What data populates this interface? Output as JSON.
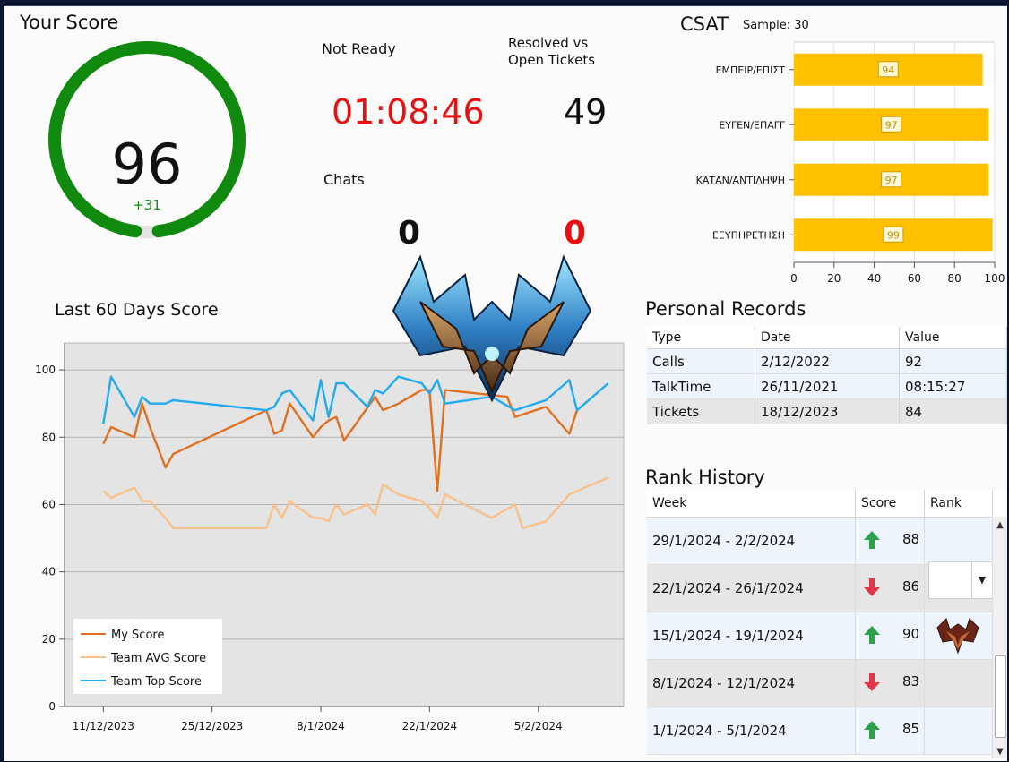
{
  "score": {
    "title": "Your Score",
    "value": "96",
    "delta": "+31",
    "percent": 96
  },
  "not_ready": {
    "label": "Not Ready",
    "value": "01:08:46"
  },
  "resolved": {
    "label_line1": "Resolved vs",
    "label_line2": "Open Tickets",
    "value": "49"
  },
  "chats": {
    "label": "Chats",
    "value_a": "0",
    "value_b": "0"
  },
  "csat": {
    "title": "CSAT",
    "sample": "Sample: 30",
    "chart_data": {
      "type": "bar",
      "orientation": "horizontal",
      "categories": [
        "ΕΜΠΕΙΡ/ΕΠΙΣΤ",
        "ΕΥΓΕΝ/ΕΠΑΓΓ",
        "ΚΑΤΑΝ/ΑΝΤΙΛΗΨΗ",
        "ΕΞΥΠΗΡΕΤΗΣΗ"
      ],
      "values": [
        94,
        97,
        97,
        99
      ],
      "xlim": [
        0,
        100
      ],
      "ticks": [
        "0",
        "20",
        "40",
        "60",
        "80",
        "100"
      ],
      "color": "#ffc000"
    }
  },
  "line_chart": {
    "title": "Last 60 Days Score",
    "chart_data": {
      "type": "line",
      "ylim": [
        0,
        108
      ],
      "yticks": [
        "0",
        "20",
        "40",
        "60",
        "80",
        "100"
      ],
      "x_ticks": [
        {
          "label": "11/12/2023",
          "date": "2023-12-11"
        },
        {
          "label": "25/12/2023",
          "date": "2023-12-25"
        },
        {
          "label": "8/1/2024",
          "date": "2024-01-08"
        },
        {
          "label": "22/1/2024",
          "date": "2024-01-22"
        },
        {
          "label": "5/2/2024",
          "date": "2024-02-05"
        }
      ],
      "xlim": [
        "2023-12-06",
        "2024-02-16"
      ],
      "series": [
        {
          "name": "My Score",
          "color": "#e07020",
          "points": [
            [
              "2023-12-11",
              78
            ],
            [
              "2023-12-12",
              83
            ],
            [
              "2023-12-15",
              80
            ],
            [
              "2023-12-16",
              90
            ],
            [
              "2023-12-17",
              83
            ],
            [
              "2023-12-19",
              71
            ],
            [
              "2023-12-20",
              75
            ],
            [
              "2024-01-01",
              88
            ],
            [
              "2024-01-02",
              81
            ],
            [
              "2024-01-03",
              82
            ],
            [
              "2024-01-04",
              90
            ],
            [
              "2024-01-07",
              80
            ],
            [
              "2024-01-08",
              83
            ],
            [
              "2024-01-09",
              85
            ],
            [
              "2024-01-10",
              86
            ],
            [
              "2024-01-11",
              79
            ],
            [
              "2024-01-15",
              92
            ],
            [
              "2024-01-16",
              88
            ],
            [
              "2024-01-18",
              90
            ],
            [
              "2024-01-21",
              94
            ],
            [
              "2024-01-22",
              94
            ],
            [
              "2024-01-23",
              64
            ],
            [
              "2024-01-24",
              94
            ],
            [
              "2024-02-01",
              92
            ],
            [
              "2024-02-02",
              86
            ],
            [
              "2024-02-06",
              89
            ],
            [
              "2024-02-09",
              81
            ],
            [
              "2024-02-10",
              88
            ]
          ]
        },
        {
          "name": "Team AVG Score",
          "color": "#f8c08a",
          "points": [
            [
              "2023-12-11",
              64
            ],
            [
              "2023-12-12",
              62
            ],
            [
              "2023-12-15",
              65
            ],
            [
              "2023-12-16",
              61
            ],
            [
              "2023-12-17",
              61
            ],
            [
              "2023-12-19",
              56
            ],
            [
              "2023-12-20",
              53
            ],
            [
              "2024-01-01",
              53
            ],
            [
              "2024-01-02",
              60
            ],
            [
              "2024-01-03",
              56
            ],
            [
              "2024-01-04",
              61
            ],
            [
              "2024-01-07",
              56
            ],
            [
              "2024-01-08",
              56
            ],
            [
              "2024-01-09",
              55
            ],
            [
              "2024-01-10",
              60
            ],
            [
              "2024-01-11",
              57
            ],
            [
              "2024-01-14",
              60
            ],
            [
              "2024-01-15",
              57
            ],
            [
              "2024-01-16",
              66
            ],
            [
              "2024-01-18",
              63
            ],
            [
              "2024-01-21",
              61
            ],
            [
              "2024-01-22",
              59
            ],
            [
              "2024-01-23",
              56
            ],
            [
              "2024-01-24",
              63
            ],
            [
              "2024-01-30",
              56
            ],
            [
              "2024-02-02",
              60
            ],
            [
              "2024-02-03",
              53
            ],
            [
              "2024-02-06",
              55
            ],
            [
              "2024-02-09",
              63
            ],
            [
              "2024-02-14",
              68
            ]
          ]
        },
        {
          "name": "Team Top Score",
          "color": "#22aaee",
          "points": [
            [
              "2023-12-11",
              84
            ],
            [
              "2023-12-12",
              98
            ],
            [
              "2023-12-15",
              86
            ],
            [
              "2023-12-16",
              92
            ],
            [
              "2023-12-17",
              90
            ],
            [
              "2023-12-19",
              90
            ],
            [
              "2023-12-20",
              91
            ],
            [
              "2024-01-01",
              88
            ],
            [
              "2024-01-02",
              89
            ],
            [
              "2024-01-03",
              93
            ],
            [
              "2024-01-04",
              94
            ],
            [
              "2024-01-07",
              85
            ],
            [
              "2024-01-08",
              97
            ],
            [
              "2024-01-09",
              86
            ],
            [
              "2024-01-10",
              96
            ],
            [
              "2024-01-11",
              96
            ],
            [
              "2024-01-14",
              89
            ],
            [
              "2024-01-15",
              94
            ],
            [
              "2024-01-16",
              93
            ],
            [
              "2024-01-18",
              98
            ],
            [
              "2024-01-21",
              96
            ],
            [
              "2024-01-22",
              93
            ],
            [
              "2024-01-23",
              97
            ],
            [
              "2024-01-24",
              90
            ],
            [
              "2024-01-30",
              92
            ],
            [
              "2024-02-02",
              88
            ],
            [
              "2024-02-06",
              91
            ],
            [
              "2024-02-09",
              97
            ],
            [
              "2024-02-10",
              88
            ],
            [
              "2024-02-14",
              96
            ]
          ]
        }
      ]
    }
  },
  "records": {
    "title": "Personal Records",
    "columns": [
      "Type",
      "Date",
      "Value"
    ],
    "rows": [
      [
        "Calls",
        "2/12/2022",
        "92"
      ],
      [
        "TalkTime",
        "26/11/2021",
        "08:15:27"
      ],
      [
        "Tickets",
        "18/12/2023",
        "84"
      ]
    ]
  },
  "rank": {
    "title": "Rank History",
    "columns": [
      "Week",
      "Score",
      "Rank"
    ],
    "rows": [
      {
        "week": "29/1/2024 - 2/2/2024",
        "score": "88",
        "trend": "up"
      },
      {
        "week": "22/1/2024 - 26/1/2024",
        "score": "86",
        "trend": "down"
      },
      {
        "week": "15/1/2024 - 19/1/2024",
        "score": "90",
        "trend": "up"
      },
      {
        "week": "8/1/2024 - 12/1/2024",
        "score": "83",
        "trend": "down"
      },
      {
        "week": "1/1/2024 - 5/1/2024",
        "score": "85",
        "trend": "up"
      }
    ]
  },
  "colors": {
    "gauge": "#0f8a0f",
    "gauge_track": "#e3e3e3",
    "up": "#2aa14a",
    "down": "#e0384a",
    "plot_bg": "#e4e4e4"
  }
}
